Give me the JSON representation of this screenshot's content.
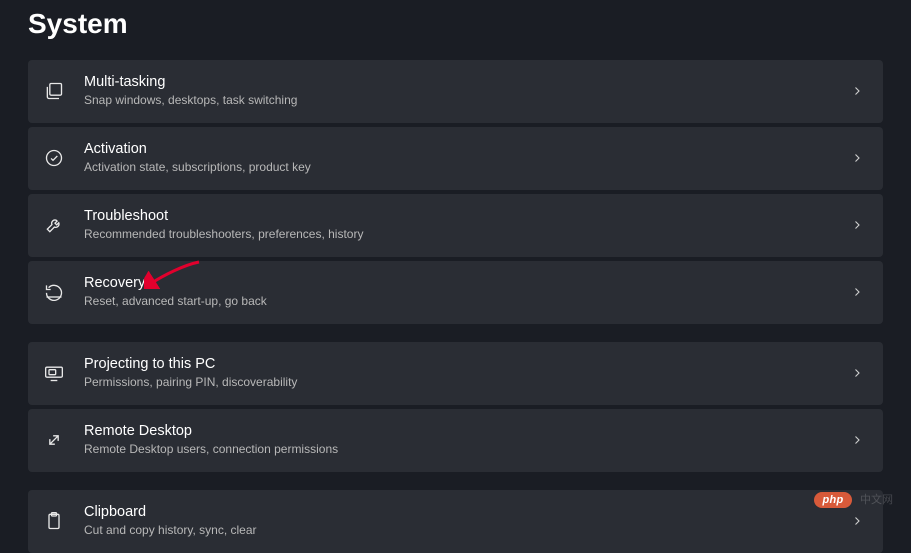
{
  "page_title": "System",
  "items": [
    {
      "title": "Multi-tasking",
      "sub": "Snap windows, desktops, task switching"
    },
    {
      "title": "Activation",
      "sub": "Activation state, subscriptions, product key"
    },
    {
      "title": "Troubleshoot",
      "sub": "Recommended troubleshooters, preferences, history"
    },
    {
      "title": "Recovery",
      "sub": "Reset, advanced start-up, go back"
    },
    {
      "title": "Projecting to this PC",
      "sub": "Permissions, pairing PIN, discoverability"
    },
    {
      "title": "Remote Desktop",
      "sub": "Remote Desktop users, connection permissions"
    },
    {
      "title": "Clipboard",
      "sub": "Cut and copy history, sync, clear"
    }
  ],
  "watermark": {
    "badge": "php",
    "text": "中文网"
  },
  "arrow_color": "#e1002d"
}
